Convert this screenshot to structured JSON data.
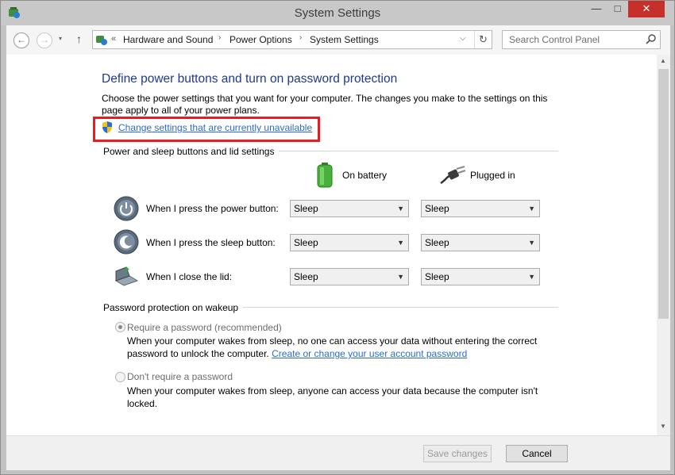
{
  "window": {
    "title": "System Settings",
    "minimize": "—",
    "maximize": "□",
    "close": "✕"
  },
  "nav": {
    "back": "←",
    "forward": "→",
    "dropdown": "▾",
    "up": "↑",
    "breadcrumb_overflow": "«",
    "breadcrumbs": [
      "Hardware and Sound",
      "Power Options",
      "System Settings"
    ],
    "separator": "›",
    "address_dropdown": "⌵",
    "refresh": "↻",
    "search_placeholder": "Search Control Panel"
  },
  "page": {
    "heading": "Define power buttons and turn on password protection",
    "intro": "Choose the power settings that you want for your computer. The changes you make to the settings on this page apply to all of your power plans.",
    "change_link": "Change settings that are currently unavailable",
    "buttons_group": {
      "title": "Power and sleep buttons and lid settings",
      "col_battery": "On battery",
      "col_plugged": "Plugged in",
      "rows": [
        {
          "label": "When I press the power button:",
          "battery": "Sleep",
          "plugged": "Sleep"
        },
        {
          "label": "When I press the sleep button:",
          "battery": "Sleep",
          "plugged": "Sleep"
        },
        {
          "label": "When I close the lid:",
          "battery": "Sleep",
          "plugged": "Sleep"
        }
      ]
    },
    "password_group": {
      "title": "Password protection on wakeup",
      "require_label": "Require a password (recommended)",
      "require_desc": "When your computer wakes from sleep, no one can access your data without entering the correct password to unlock the computer.",
      "require_link": "Create or change your user account password",
      "dont_label": "Don't require a password",
      "dont_desc": "When your computer wakes from sleep, anyone can access your data because the computer isn't locked.",
      "selected": "require"
    }
  },
  "footer": {
    "save": "Save changes",
    "cancel": "Cancel"
  },
  "colors": {
    "heading": "#1e3a8a",
    "link": "#2a6bcf",
    "highlight": "#e81c24",
    "close_button": "#c7302a"
  }
}
